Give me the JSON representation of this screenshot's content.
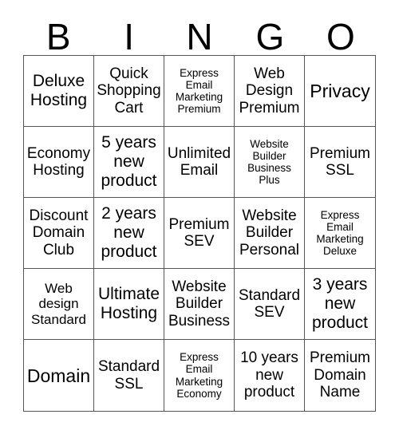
{
  "card": {
    "title": "BINGO",
    "header_letters": [
      "B",
      "I",
      "N",
      "G",
      "O"
    ],
    "grid_size": "5x5",
    "border_color": "#555555",
    "text_color": "#000000",
    "background_color": "#ffffff",
    "rows": [
      [
        {
          "text": "Deluxe Hosting",
          "size": "lg"
        },
        {
          "text": "Quick Shopping Cart",
          "size": "md"
        },
        {
          "text": "Express Email Marketing Premium",
          "size": "xs"
        },
        {
          "text": "Web Design Premium",
          "size": "md"
        },
        {
          "text": "Privacy",
          "size": "xl"
        }
      ],
      [
        {
          "text": "Economy Hosting",
          "size": "md"
        },
        {
          "text": "5 years new product",
          "size": "lg"
        },
        {
          "text": "Unlimited Email",
          "size": "md"
        },
        {
          "text": "Website Builder Business Plus",
          "size": "xs"
        },
        {
          "text": "Premium SSL",
          "size": "md"
        }
      ],
      [
        {
          "text": "Discount Domain Club",
          "size": "md"
        },
        {
          "text": "2 years new product",
          "size": "lg"
        },
        {
          "text": "Premium SEV",
          "size": "md"
        },
        {
          "text": "Website Builder Personal",
          "size": "md"
        },
        {
          "text": "Express Email Marketing Deluxe",
          "size": "xs"
        }
      ],
      [
        {
          "text": "Web design Standard",
          "size": "sm"
        },
        {
          "text": "Ultimate Hosting",
          "size": "lg"
        },
        {
          "text": "Website Builder Business",
          "size": "md"
        },
        {
          "text": "Standard SEV",
          "size": "md"
        },
        {
          "text": "3 years new product",
          "size": "lg"
        }
      ],
      [
        {
          "text": "Domain",
          "size": "xl"
        },
        {
          "text": "Standard SSL",
          "size": "md"
        },
        {
          "text": "Express Email Marketing Economy",
          "size": "xs"
        },
        {
          "text": "10 years new product",
          "size": "md"
        },
        {
          "text": "Premium Domain Name",
          "size": "md"
        }
      ]
    ]
  }
}
